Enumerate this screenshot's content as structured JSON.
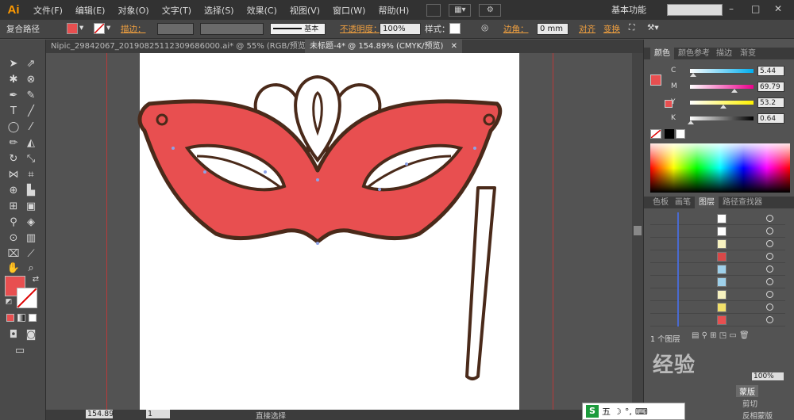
{
  "app": {
    "logo": "Ai"
  },
  "menu": [
    "文件(F)",
    "编辑(E)",
    "对象(O)",
    "文字(T)",
    "选择(S)",
    "效果(C)",
    "视图(V)",
    "窗口(W)",
    "帮助(H)"
  ],
  "workspace": "基本功能",
  "window_controls": [
    "–",
    "□",
    "✕"
  ],
  "control_bar": {
    "selection_type": "复合路径",
    "stroke_label": "描边：",
    "stroke_profile": "基本",
    "opacity_label": "不透明度：",
    "opacity_value": "100%",
    "style_label": "样式：",
    "corner_label": "边角：",
    "corner_value": "0 mm",
    "align_label": "对齐",
    "transform_label": "变换"
  },
  "tabs": [
    {
      "label": "Nipic_29842067_20190825112309686000.ai* @ 55% (RGB/预览)",
      "close": "✕"
    },
    {
      "label": "未标题-4* @ 154.89% (CMYK/预览)",
      "close": "✕"
    }
  ],
  "status_bar": {
    "zoom": "154.89",
    "page": "1",
    "tool": "直接选择"
  },
  "color_panel": {
    "tabs": [
      "颜色",
      "颜色参考",
      "描边",
      "渐变"
    ],
    "sliders": [
      {
        "label": "C",
        "value": "5.44",
        "fraction": 0.05
      },
      {
        "label": "M",
        "value": "69.79",
        "fraction": 0.7
      },
      {
        "label": "Y",
        "value": "53.2",
        "fraction": 0.53
      },
      {
        "label": "K",
        "value": "0.64",
        "fraction": 0.01
      }
    ]
  },
  "layers_panel": {
    "tabs": [
      "色板",
      "画笔",
      "图层",
      "路径查找器"
    ],
    "footer": "1 个图层",
    "row_count": 9
  },
  "lower_panel": {
    "items": [
      "剪切",
      "反相蒙版"
    ],
    "button": "蒙版"
  },
  "taskbar": {
    "ime": "五",
    "icons": [
      "☽",
      "°,",
      "⌨"
    ]
  },
  "watermark": "经验",
  "colors": {
    "mask_fill": "#e84f50",
    "mask_stroke": "#4a2a1a",
    "accent": "#ff9a00"
  }
}
